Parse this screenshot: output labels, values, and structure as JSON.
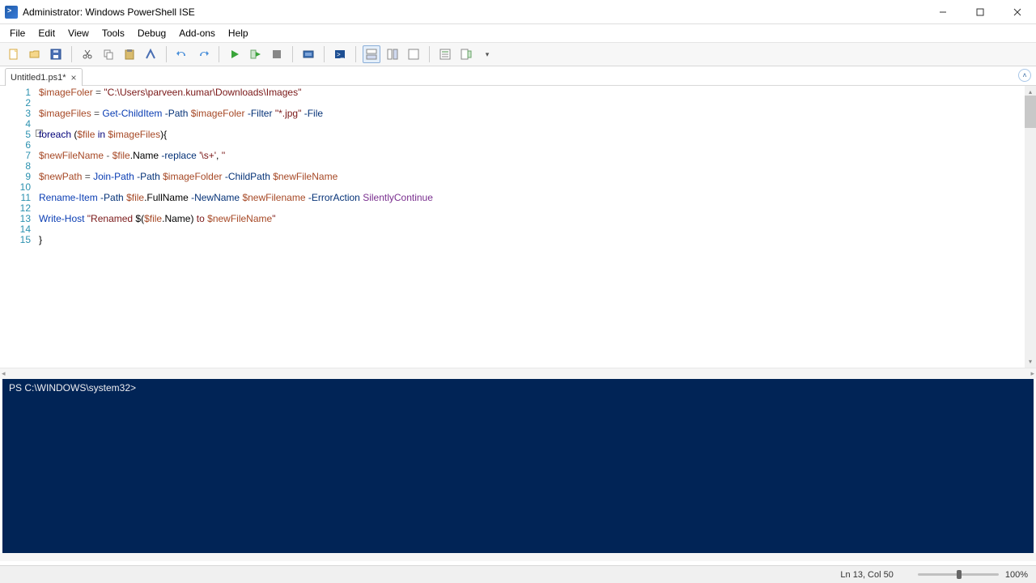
{
  "window": {
    "title": "Administrator: Windows PowerShell ISE"
  },
  "menu": {
    "items": [
      "File",
      "Edit",
      "View",
      "Tools",
      "Debug",
      "Add-ons",
      "Help"
    ]
  },
  "tab": {
    "label": "Untitled1.ps1*"
  },
  "code": {
    "lines": [
      {
        "n": 1,
        "tokens": [
          {
            "t": "$imageFoler",
            "c": "c-var"
          },
          {
            "t": " = ",
            "c": "c-op"
          },
          {
            "t": "\"C:\\Users\\parveen.kumar\\Downloads\\Images\"",
            "c": "c-str"
          }
        ]
      },
      {
        "n": 2,
        "tokens": []
      },
      {
        "n": 3,
        "tokens": [
          {
            "t": "$imageFiles",
            "c": "c-var"
          },
          {
            "t": " = ",
            "c": "c-op"
          },
          {
            "t": "Get-ChildItem",
            "c": "c-cmd"
          },
          {
            "t": " -Path ",
            "c": "c-param"
          },
          {
            "t": "$imageFoler",
            "c": "c-var"
          },
          {
            "t": " -Filter ",
            "c": "c-param"
          },
          {
            "t": "\"*.jpg\"",
            "c": "c-str"
          },
          {
            "t": " -File",
            "c": "c-param"
          }
        ]
      },
      {
        "n": 4,
        "tokens": []
      },
      {
        "n": 5,
        "tokens": [
          {
            "t": "foreach",
            "c": "c-key"
          },
          {
            "t": " (",
            "c": "c-norm"
          },
          {
            "t": "$file",
            "c": "c-var"
          },
          {
            "t": " in ",
            "c": "c-key"
          },
          {
            "t": "$imageFiles",
            "c": "c-var"
          },
          {
            "t": "){",
            "c": "c-norm"
          }
        ]
      },
      {
        "n": 6,
        "tokens": []
      },
      {
        "n": 7,
        "tokens": [
          {
            "t": "$newFileName",
            "c": "c-var"
          },
          {
            "t": " - ",
            "c": "c-op"
          },
          {
            "t": "$file",
            "c": "c-var"
          },
          {
            "t": ".Name ",
            "c": "c-member"
          },
          {
            "t": "-replace ",
            "c": "c-param"
          },
          {
            "t": "'\\s+'",
            "c": "c-str"
          },
          {
            "t": ", ",
            "c": "c-norm"
          },
          {
            "t": "''",
            "c": "c-str"
          }
        ]
      },
      {
        "n": 8,
        "tokens": []
      },
      {
        "n": 9,
        "tokens": [
          {
            "t": "$newPath",
            "c": "c-var"
          },
          {
            "t": " = ",
            "c": "c-op"
          },
          {
            "t": "Join-Path",
            "c": "c-cmd"
          },
          {
            "t": " -Path ",
            "c": "c-param"
          },
          {
            "t": "$imageFolder",
            "c": "c-var"
          },
          {
            "t": " -ChildPath ",
            "c": "c-param"
          },
          {
            "t": "$newFileName",
            "c": "c-var"
          }
        ]
      },
      {
        "n": 10,
        "tokens": []
      },
      {
        "n": 11,
        "tokens": [
          {
            "t": "Rename-Item",
            "c": "c-cmd"
          },
          {
            "t": " -Path ",
            "c": "c-param"
          },
          {
            "t": "$file",
            "c": "c-var"
          },
          {
            "t": ".FullName ",
            "c": "c-member"
          },
          {
            "t": "-NewName ",
            "c": "c-param"
          },
          {
            "t": "$newFilename",
            "c": "c-var"
          },
          {
            "t": " -ErrorAction ",
            "c": "c-errparam"
          },
          {
            "t": "SilentlyContinue",
            "c": "c-silent"
          }
        ]
      },
      {
        "n": 12,
        "tokens": []
      },
      {
        "n": 13,
        "tokens": [
          {
            "t": "Write-Host",
            "c": "c-cmd"
          },
          {
            "t": " ",
            "c": "c-norm"
          },
          {
            "t": "\"Renamed ",
            "c": "c-str"
          },
          {
            "t": "$(",
            "c": "c-norm"
          },
          {
            "t": "$file",
            "c": "c-var"
          },
          {
            "t": ".Name",
            "c": "c-member"
          },
          {
            "t": ")",
            "c": "c-norm"
          },
          {
            "t": " to ",
            "c": "c-str"
          },
          {
            "t": "$newFileName",
            "c": "c-var"
          },
          {
            "t": "\"",
            "c": "c-str"
          }
        ]
      },
      {
        "n": 14,
        "tokens": []
      },
      {
        "n": 15,
        "tokens": [
          {
            "t": "}",
            "c": "c-norm"
          }
        ]
      }
    ]
  },
  "console": {
    "prompt": "PS C:\\WINDOWS\\system32>"
  },
  "status": {
    "position": "Ln 13, Col 50",
    "zoom": "100%"
  }
}
